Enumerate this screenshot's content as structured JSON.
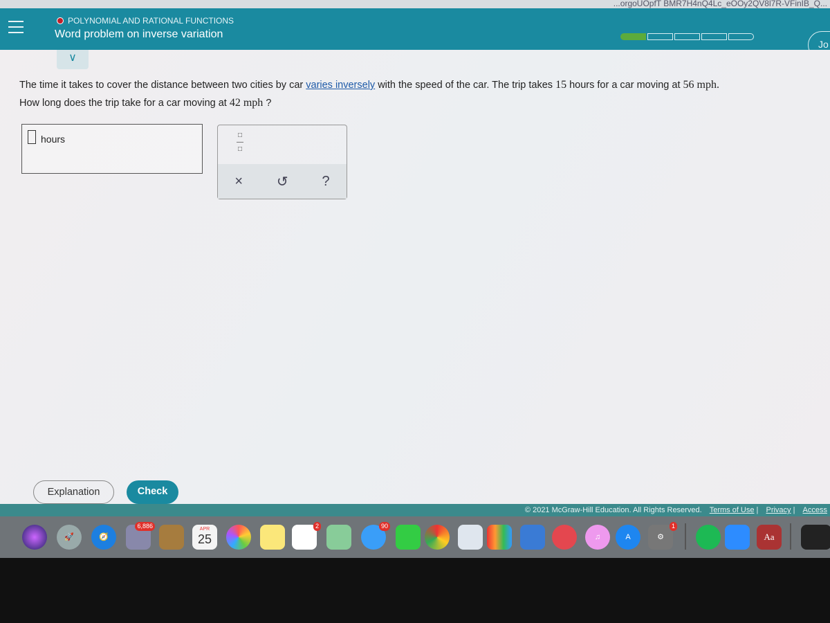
{
  "browser": {
    "url_fragment": "...orgoUOpfT BMR7H4nQ4Lc_eOOy2QV8l7R-VFinIB_Q..."
  },
  "header": {
    "topic": "POLYNOMIAL AND RATIONAL FUNCTIONS",
    "title": "Word problem on inverse variation",
    "progress": {
      "completed": 1,
      "total": 5
    },
    "join_label": "Jo",
    "accent": "#1a8aa0"
  },
  "question": {
    "part1": "The time it takes to cover the distance between two cities by car ",
    "link": "varies inversely",
    "part2": " with the speed of the car. The trip takes ",
    "t1": "15",
    "part3": " hours for a car moving at ",
    "s1": "56",
    "unit1": " mph.",
    "line2a": "How long does the trip take for a car moving at ",
    "s2": "42",
    "unit2": " mph",
    "line2b": " ?"
  },
  "answer": {
    "value": "",
    "unit": "hours"
  },
  "tools": {
    "fraction": "□/□",
    "clear": "×",
    "undo": "↺",
    "help": "?"
  },
  "buttons": {
    "explanation": "Explanation",
    "check": "Check"
  },
  "footer": {
    "copyright": "© 2021 McGraw-Hill Education. All Rights Reserved.",
    "terms": "Terms of Use",
    "privacy": "Privacy",
    "accessibility": "Access"
  },
  "dock": {
    "mail_badge": "6,886",
    "calendar_month": "APR",
    "calendar_day": "25",
    "reminders_badge": "2",
    "messages_badge": "90",
    "prefs_badge": "1",
    "dictionary": "Aa"
  }
}
